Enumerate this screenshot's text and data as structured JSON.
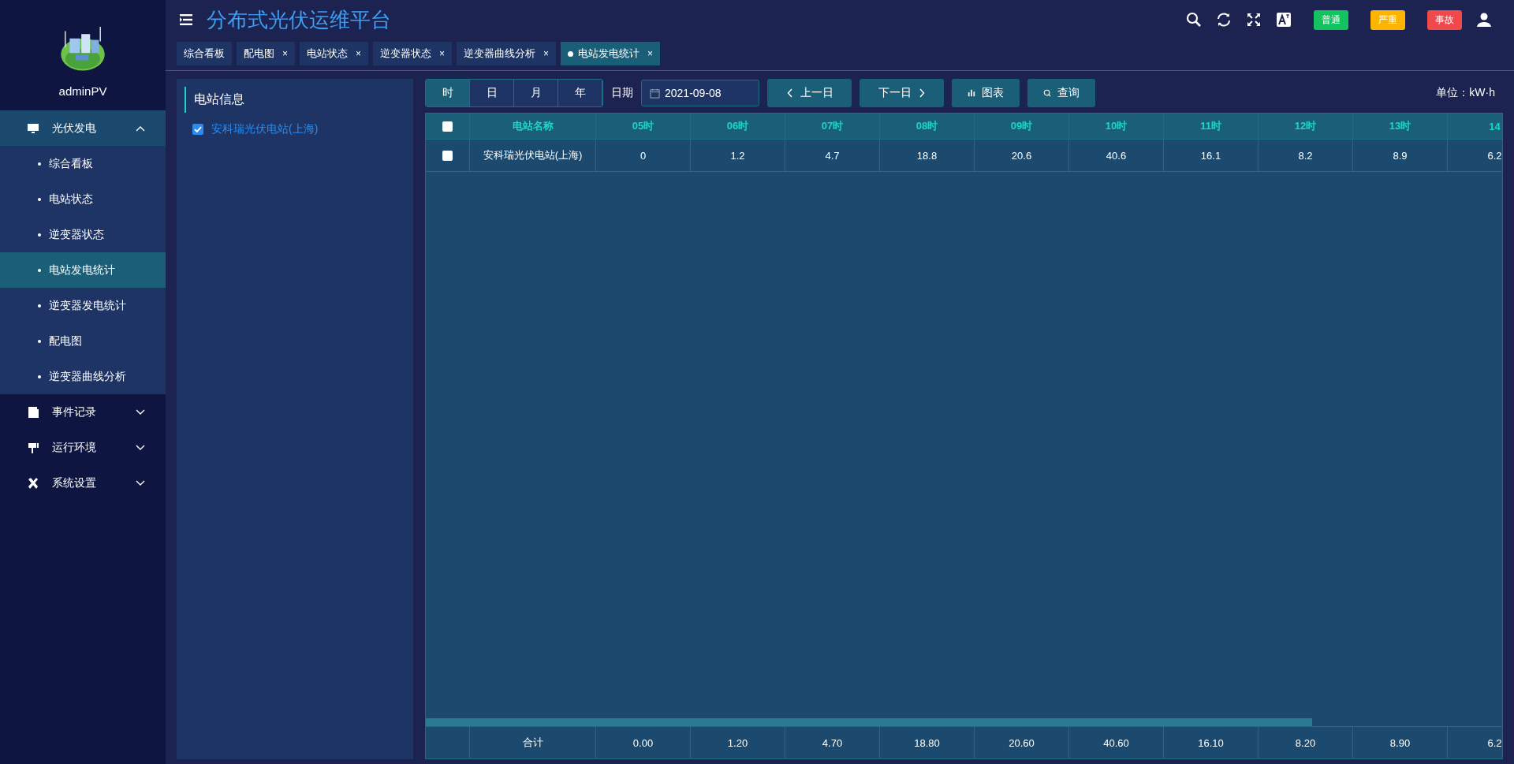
{
  "header": {
    "title": "分布式光伏运维平台",
    "badges": [
      {
        "label": "普通",
        "color": "#13c35f"
      },
      {
        "label": "严重",
        "color": "#fbb500"
      },
      {
        "label": "事故",
        "color": "#f0484b"
      }
    ]
  },
  "tabs": [
    {
      "label": "综合看板",
      "closable": false,
      "selected": false
    },
    {
      "label": "配电图",
      "closable": true,
      "selected": false
    },
    {
      "label": "电站状态",
      "closable": true,
      "selected": false
    },
    {
      "label": "逆变器状态",
      "closable": true,
      "selected": false
    },
    {
      "label": "逆变器曲线分析",
      "closable": true,
      "selected": false
    },
    {
      "label": "电站发电统计",
      "closable": true,
      "selected": true
    }
  ],
  "tab_close": "×",
  "sidebar": {
    "user": "adminPV",
    "menu": [
      {
        "label": "光伏发电",
        "expanded": true,
        "children": [
          {
            "label": "综合看板",
            "selected": false
          },
          {
            "label": "电站状态",
            "selected": false
          },
          {
            "label": "逆变器状态",
            "selected": false
          },
          {
            "label": "电站发电统计",
            "selected": true
          },
          {
            "label": "逆变器发电统计",
            "selected": false
          },
          {
            "label": "配电图",
            "selected": false
          },
          {
            "label": "逆变器曲线分析",
            "selected": false
          }
        ]
      },
      {
        "label": "事件记录",
        "expanded": false
      },
      {
        "label": "运行环境",
        "expanded": false
      },
      {
        "label": "系统设置",
        "expanded": false
      }
    ]
  },
  "station_panel": {
    "title": "电站信息",
    "stations": [
      {
        "label": "安科瑞光伏电站(上海)",
        "checked": true
      }
    ]
  },
  "toolbar": {
    "periods": [
      {
        "label": "时",
        "selected": true
      },
      {
        "label": "日",
        "selected": false
      },
      {
        "label": "月",
        "selected": false
      },
      {
        "label": "年",
        "selected": false
      }
    ],
    "date_label": "日期",
    "date": "2021-09-08",
    "prev": "上一日",
    "next": "下一日",
    "chart_button": "图表",
    "query_button": "查询",
    "unit": "单位：kW·h"
  },
  "table": {
    "header_checked": false,
    "columns": [
      "电站名称",
      "05时",
      "06时",
      "07时",
      "08时",
      "09时",
      "10时",
      "11时",
      "12时",
      "13时",
      "14"
    ],
    "rows": [
      {
        "checked": false,
        "cells": [
          "安科瑞光伏电站(上海)",
          "0",
          "1.2",
          "4.7",
          "18.8",
          "20.6",
          "40.6",
          "16.1",
          "8.2",
          "8.9",
          "6.2"
        ]
      }
    ],
    "total_label": "合计",
    "totals": [
      "0.00",
      "1.20",
      "4.70",
      "18.80",
      "20.60",
      "40.60",
      "16.10",
      "8.20",
      "8.90",
      "6.2"
    ]
  }
}
